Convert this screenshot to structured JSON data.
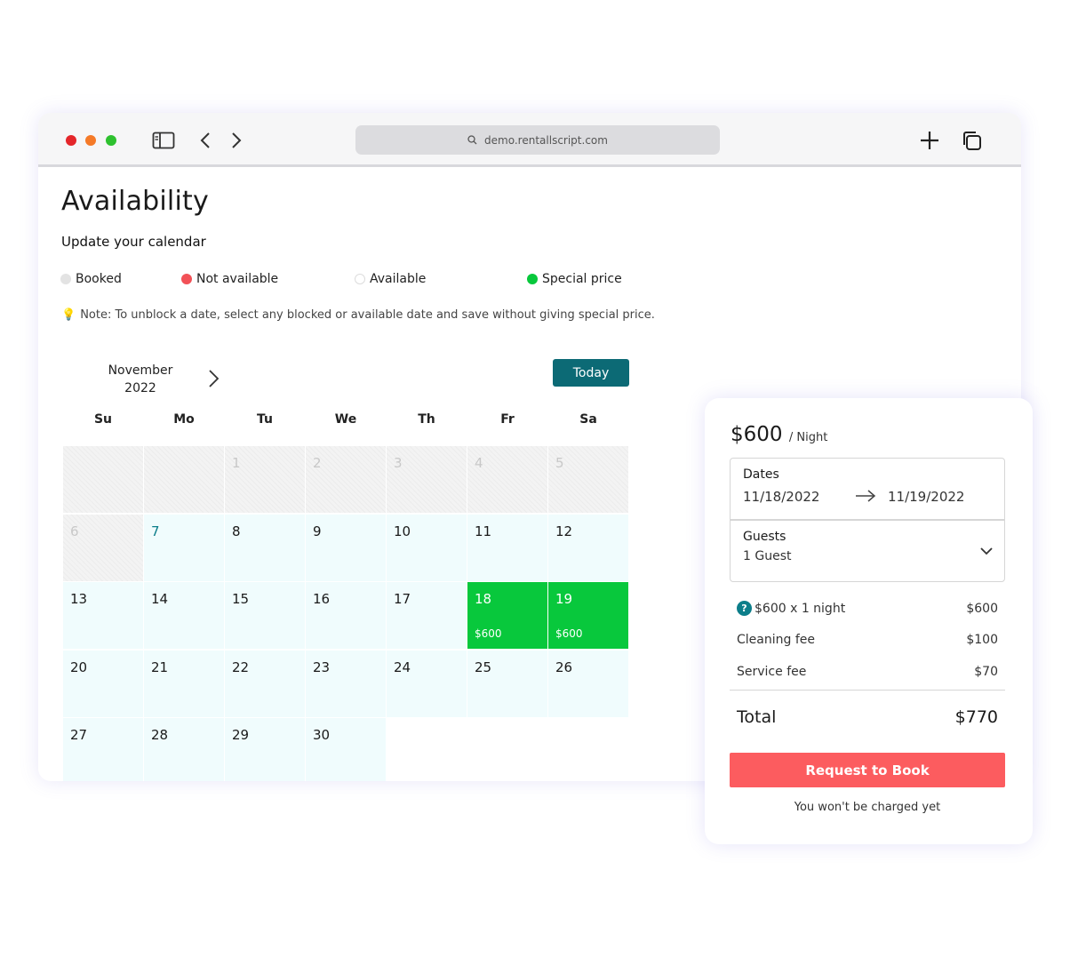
{
  "browser": {
    "url": "demo.rentallscript.com"
  },
  "page": {
    "title": "Availability",
    "subtitle": "Update your calendar",
    "legend": [
      {
        "label": "Booked",
        "color": "#e3e3e3"
      },
      {
        "label": "Not available",
        "color": "#f25157"
      },
      {
        "label": "Available",
        "color": "#ffffff"
      },
      {
        "label": "Special price",
        "color": "#08c83c"
      }
    ],
    "note": "Note: To unblock a date, select any blocked or available date and save without giving special price."
  },
  "calendar": {
    "month": "November",
    "year": "2022",
    "today_label": "Today",
    "weekdays": [
      "Su",
      "Mo",
      "Tu",
      "We",
      "Th",
      "Fr",
      "Sa"
    ],
    "weeks": [
      [
        {
          "day": "",
          "state": "blocked"
        },
        {
          "day": "",
          "state": "blocked"
        },
        {
          "day": "1",
          "state": "blocked"
        },
        {
          "day": "2",
          "state": "blocked"
        },
        {
          "day": "3",
          "state": "blocked"
        },
        {
          "day": "4",
          "state": "blocked"
        },
        {
          "day": "5",
          "state": "blocked"
        }
      ],
      [
        {
          "day": "6",
          "state": "blocked"
        },
        {
          "day": "7",
          "state": "today"
        },
        {
          "day": "8",
          "state": "available"
        },
        {
          "day": "9",
          "state": "available"
        },
        {
          "day": "10",
          "state": "available"
        },
        {
          "day": "11",
          "state": "available"
        },
        {
          "day": "12",
          "state": "available"
        }
      ],
      [
        {
          "day": "13",
          "state": "available"
        },
        {
          "day": "14",
          "state": "available"
        },
        {
          "day": "15",
          "state": "available"
        },
        {
          "day": "16",
          "state": "available"
        },
        {
          "day": "17",
          "state": "available"
        },
        {
          "day": "18",
          "state": "special",
          "price": "$600"
        },
        {
          "day": "19",
          "state": "special",
          "price": "$600"
        }
      ],
      [
        {
          "day": "20",
          "state": "available"
        },
        {
          "day": "21",
          "state": "available"
        },
        {
          "day": "22",
          "state": "available"
        },
        {
          "day": "23",
          "state": "available"
        },
        {
          "day": "24",
          "state": "available"
        },
        {
          "day": "25",
          "state": "available"
        },
        {
          "day": "26",
          "state": "available"
        }
      ],
      [
        {
          "day": "27",
          "state": "available"
        },
        {
          "day": "28",
          "state": "available"
        },
        {
          "day": "29",
          "state": "available"
        },
        {
          "day": "30",
          "state": "available"
        }
      ]
    ]
  },
  "booking": {
    "price": "$600",
    "per_night": "/ Night",
    "dates_label": "Dates",
    "check_in": "11/18/2022",
    "check_out": "11/19/2022",
    "guests_label": "Guests",
    "guests_value": "1 Guest",
    "lines": [
      {
        "label": "$600 x 1 night",
        "amount": "$600",
        "help": "?"
      },
      {
        "label": "Cleaning fee",
        "amount": "$100"
      },
      {
        "label": "Service fee",
        "amount": "$70"
      }
    ],
    "total_label": "Total",
    "total_amount": "$770",
    "cta": "Request to Book",
    "disclaimer": "You won't be charged yet"
  }
}
